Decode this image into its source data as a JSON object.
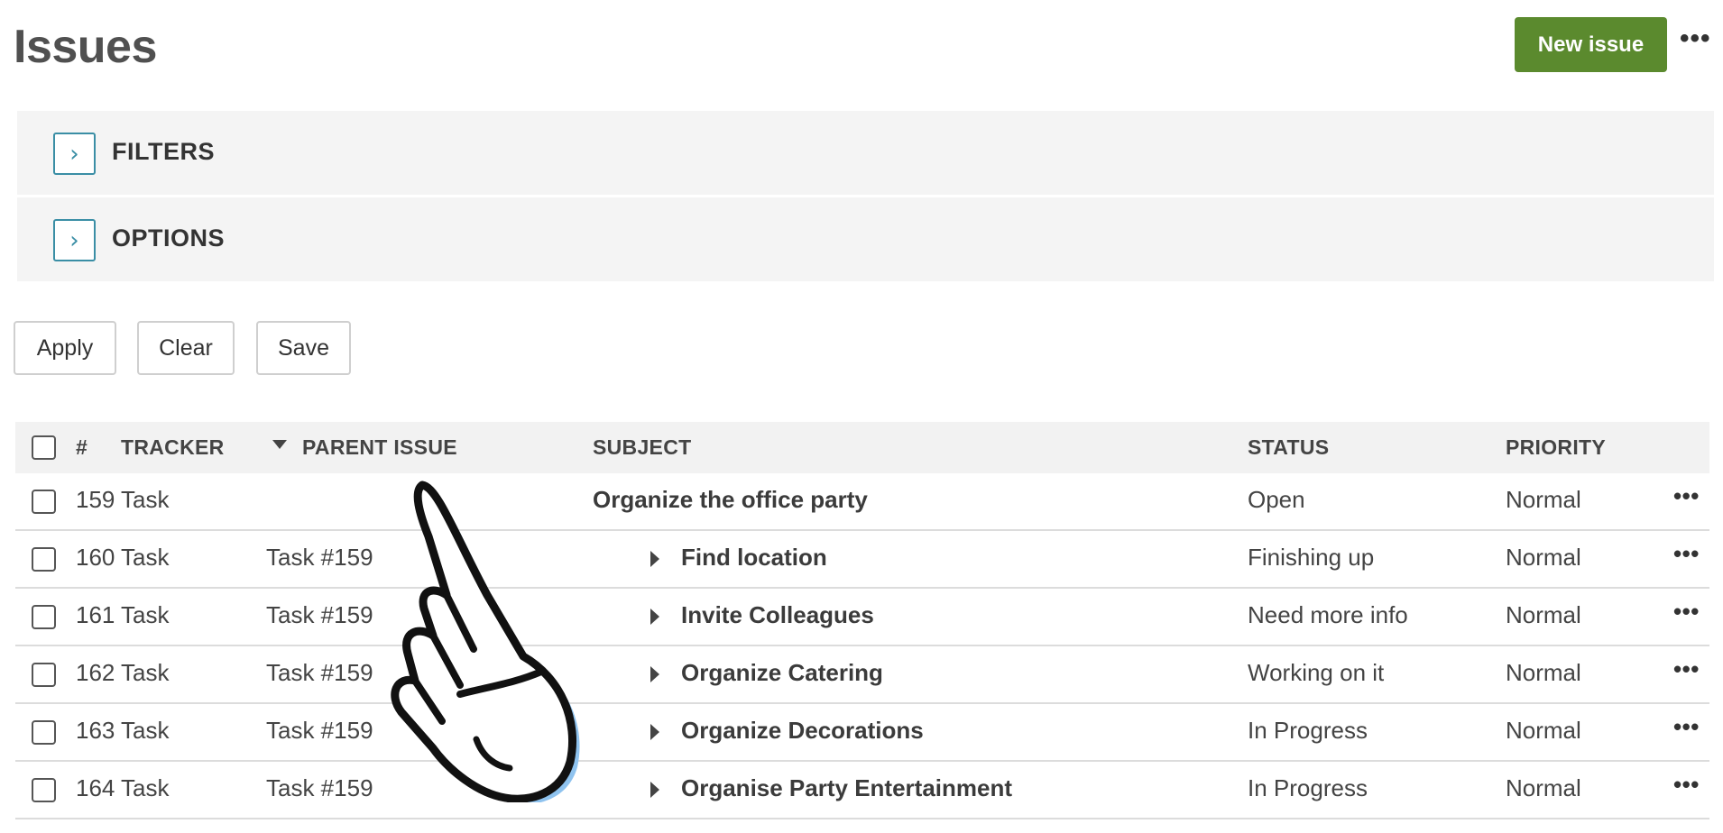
{
  "header": {
    "title": "Issues",
    "new_issue_label": "New issue",
    "more_label": "•••"
  },
  "panels": {
    "filters": {
      "label": "FILTERS",
      "toggle_icon": "chevron-right-icon"
    },
    "options": {
      "label": "OPTIONS",
      "toggle_icon": "chevron-right-icon"
    }
  },
  "actions": {
    "apply_label": "Apply",
    "clear_label": "Clear",
    "save_label": "Save"
  },
  "table": {
    "columns": {
      "id": "#",
      "tracker": "TRACKER",
      "parent": "PARENT ISSUE",
      "subject": "SUBJECT",
      "status": "STATUS",
      "priority": "PRIORITY"
    },
    "sort_icon": "caret-down-icon",
    "rows": [
      {
        "id": "159",
        "tracker": "Task",
        "parent": "",
        "subject": "Organize the office party",
        "status": "Open",
        "priority": "Normal",
        "more": "•••"
      },
      {
        "id": "160",
        "tracker": "Task",
        "parent": "Task #159",
        "subject": "Find location",
        "status": "Finishing up",
        "priority": "Normal",
        "more": "•••"
      },
      {
        "id": "161",
        "tracker": "Task",
        "parent": "Task #159",
        "subject": "Invite Colleagues",
        "status": "Need more info",
        "priority": "Normal",
        "more": "•••"
      },
      {
        "id": "162",
        "tracker": "Task",
        "parent": "Task #159",
        "subject": "Organize Catering",
        "status": "Working on it",
        "priority": "Normal",
        "more": "•••"
      },
      {
        "id": "163",
        "tracker": "Task",
        "parent": "Task #159",
        "subject": "Organize Decorations",
        "status": "In Progress",
        "priority": "Normal",
        "more": "•••"
      },
      {
        "id": "164",
        "tracker": "Task",
        "parent": "Task #159",
        "subject": "Organise Party Entertainment",
        "status": "In Progress",
        "priority": "Normal",
        "more": "•••"
      }
    ]
  },
  "overlay": {
    "icon": "pointing-hand-icon"
  },
  "colors": {
    "brand_green": "#5b8a2e",
    "toggle_blue": "#3a8ea5",
    "panel_bg": "#f4f4f4",
    "hand_shadow": "#8fc3ef"
  }
}
